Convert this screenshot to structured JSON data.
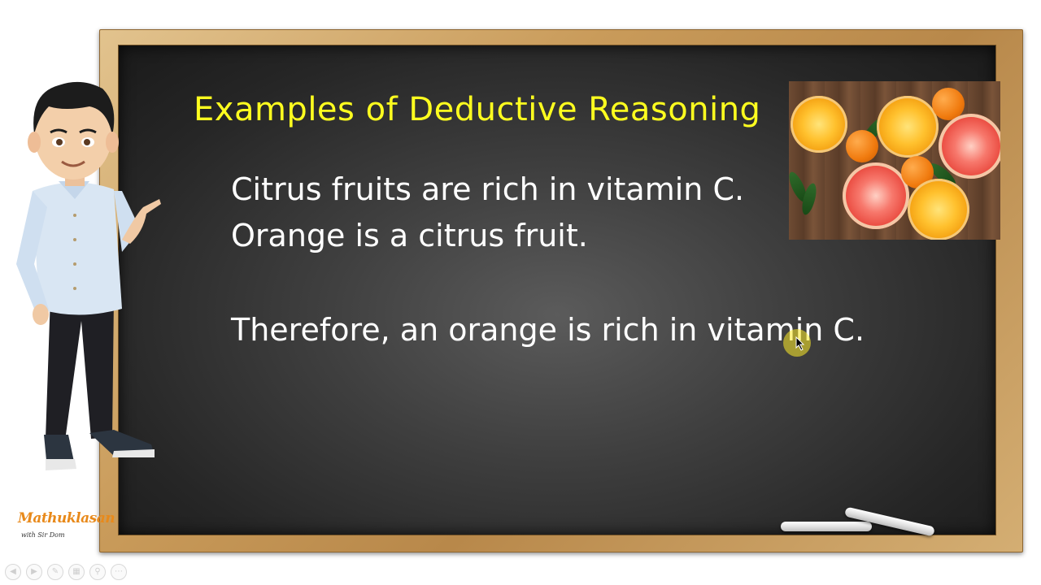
{
  "slide": {
    "title": "Examples of Deductive Reasoning",
    "statements": [
      "Citrus fruits are rich in vitamin C.",
      "Orange is a citrus fruit.",
      "Therefore, an orange is rich in vitamin C."
    ]
  },
  "branding": {
    "logo_text": "Mathuklasan",
    "logo_subtext": "with Sir Dom"
  },
  "controls": {
    "items": [
      "prev-icon",
      "next-icon",
      "pen-icon",
      "slides-icon",
      "zoom-icon",
      "more-icon"
    ]
  },
  "colors": {
    "title": "#ffff1f",
    "text": "#ffffff",
    "board": "#3a3a3a",
    "frame": "#c99b5a",
    "logo": "#e8891a"
  }
}
